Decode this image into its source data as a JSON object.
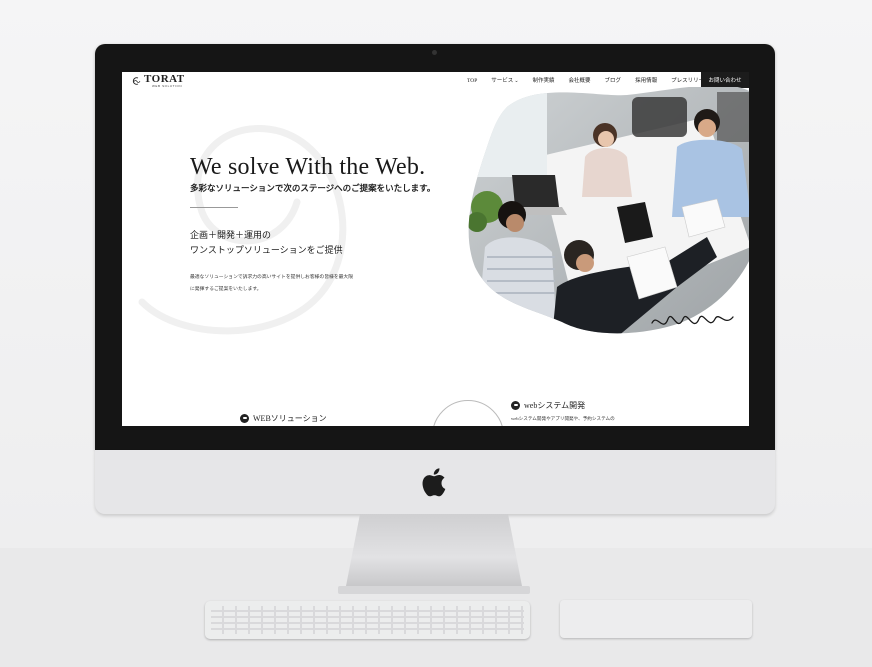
{
  "nav": {
    "logo": "TORAT",
    "logo_sub": "WEB SOLUTION",
    "items": [
      "TOP",
      "サービス",
      "制作実績",
      "会社概要",
      "ブログ",
      "採用情報",
      "プレスリリース"
    ],
    "contact": "お問い合わせ"
  },
  "hero": {
    "title": "We solve With the Web.",
    "subtitle": "多彩なソリューションで次のステージへのご提案をいたします。",
    "lead_line1": "企画＋開発＋運用の",
    "lead_line2": "ワンストップソリューションをご提供",
    "desc_line1": "最適なソリューションで訴求力の高いサイトを提供しお客様の皆様を最大限",
    "desc_line2": "に発揮するご提案をいたします。"
  },
  "services": {
    "left_label": "WEBソリューション",
    "right_label": "webシステム開発",
    "right_desc": "webシステム開発やアプリ開発や、予約システムの"
  },
  "colors": {
    "nav_contact_bg": "#1c1c1c",
    "bezel": "#151515",
    "chin": "#e6e6e8"
  },
  "icons": [
    "apple-logo-icon",
    "chevron-down-icon",
    "service-badge-icon"
  ]
}
